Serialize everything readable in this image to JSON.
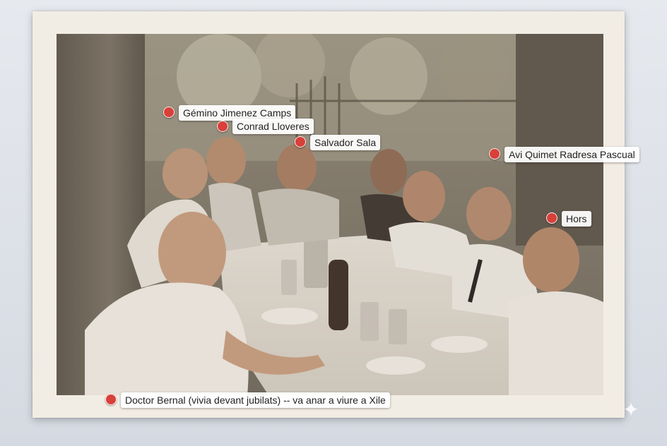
{
  "photo": {
    "description_icon": "vintage-photo-icon"
  },
  "people": [
    {
      "name": "Gémino Jimenez Camps"
    },
    {
      "name": "Conrad Lloveres"
    },
    {
      "name": "Salvador Sala"
    },
    {
      "name": "Avi Quimet Radresa Pascual"
    },
    {
      "name": "Hors"
    },
    {
      "name": "Doctor Bernal (vivia devant jubilats) -- va anar a viure a Xile"
    }
  ],
  "colors": {
    "marker": "#d9403a",
    "label_bg": "#ffffff",
    "print_border": "#f2ede4"
  }
}
